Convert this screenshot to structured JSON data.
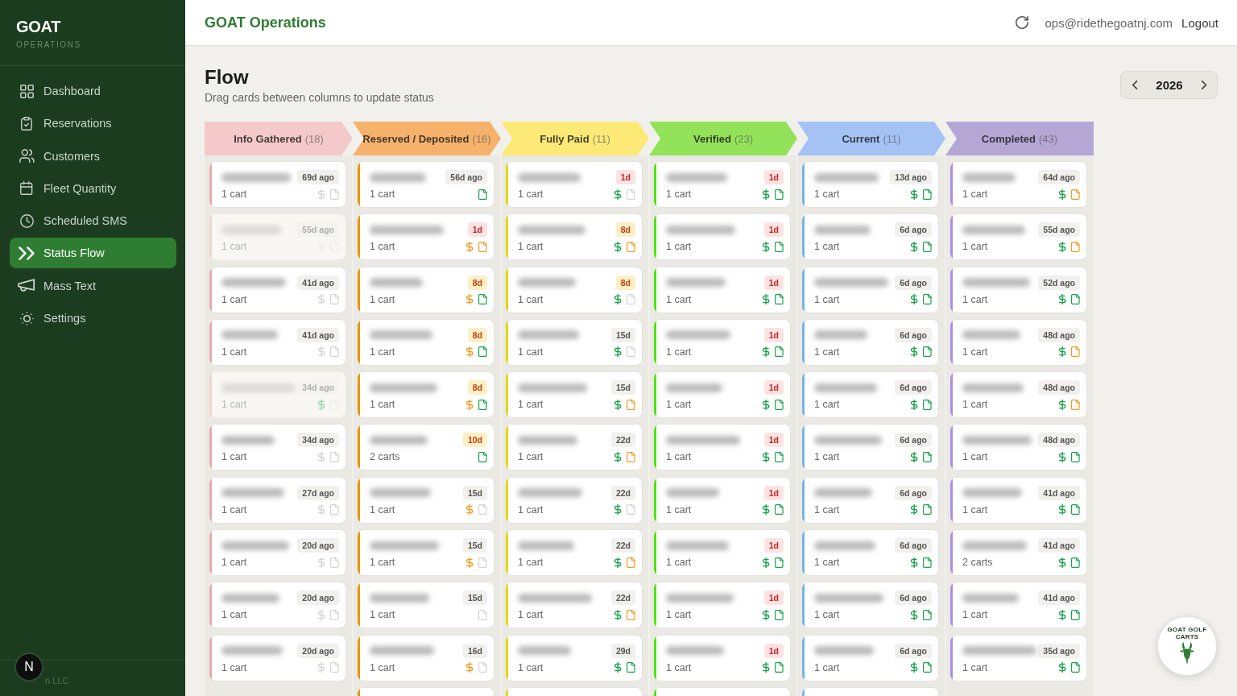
{
  "sidebar": {
    "brand": "GOAT",
    "brand_subtitle": "OPERATIONS",
    "items": [
      {
        "label": "Dashboard",
        "kind": "dashboard",
        "selected": false
      },
      {
        "label": "Reservations",
        "kind": "reservations",
        "selected": false
      },
      {
        "label": "Customers",
        "kind": "customers",
        "selected": false
      },
      {
        "label": "Fleet Quantity",
        "kind": "fleet",
        "selected": false
      },
      {
        "label": "Scheduled SMS",
        "kind": "sms",
        "selected": false
      },
      {
        "label": "Status Flow",
        "kind": "flow",
        "selected": true
      },
      {
        "label": "Mass Text",
        "kind": "mass_text",
        "selected": false
      },
      {
        "label": "Settings",
        "kind": "settings",
        "selected": false
      }
    ],
    "footer_text": "n LLC"
  },
  "header": {
    "title": "GOAT Operations",
    "email": "ops@ridethegoatnj.com",
    "logout": "Logout"
  },
  "page": {
    "title": "Flow",
    "subtitle": "Drag cards between columns to update status",
    "year": "2026"
  },
  "columns": [
    {
      "title": "Info Gathered",
      "count": "(18)",
      "color": "#f4c9c9",
      "more_below": false,
      "cards": [
        {
          "age": "69d ago",
          "urgent": false,
          "due_soon": false,
          "carts": "1 cart",
          "payment": {
            "color": "#d4d4d4"
          },
          "document": {
            "color": "#d4d4d4"
          },
          "dimmed": false
        },
        {
          "age": "55d ago",
          "urgent": false,
          "due_soon": false,
          "carts": "1 cart",
          "payment": {
            "color": "#ebebeb"
          },
          "document": {
            "color": "#ebebeb"
          },
          "dimmed": true
        },
        {
          "age": "41d ago",
          "urgent": false,
          "due_soon": false,
          "carts": "1 cart",
          "payment": {
            "color": "#d4d4d4"
          },
          "document": {
            "color": "#d4d4d4"
          },
          "dimmed": false
        },
        {
          "age": "41d ago",
          "urgent": false,
          "due_soon": false,
          "carts": "1 cart",
          "payment": {
            "color": "#d4d4d4"
          },
          "document": {
            "color": "#d4d4d4"
          },
          "dimmed": false
        },
        {
          "age": "34d ago",
          "urgent": false,
          "due_soon": false,
          "carts": "1 cart",
          "payment": {
            "color": "#96d6ae"
          },
          "document": {
            "color": "#ebebeb"
          },
          "dimmed": true
        },
        {
          "age": "34d ago",
          "urgent": false,
          "due_soon": false,
          "carts": "1 cart",
          "payment": {
            "color": "#d4d4d4"
          },
          "document": {
            "color": "#d4d4d4"
          },
          "dimmed": false
        },
        {
          "age": "27d ago",
          "urgent": false,
          "due_soon": false,
          "carts": "1 cart",
          "payment": {
            "color": "#d4d4d4"
          },
          "document": {
            "color": "#d4d4d4"
          },
          "dimmed": false
        },
        {
          "age": "20d ago",
          "urgent": false,
          "due_soon": false,
          "carts": "1 cart",
          "payment": {
            "color": "#d4d4d4"
          },
          "document": {
            "color": "#d4d4d4"
          },
          "dimmed": false
        },
        {
          "age": "20d ago",
          "urgent": false,
          "due_soon": false,
          "carts": "1 cart",
          "payment": {
            "color": "#d4d4d4"
          },
          "document": {
            "color": "#d4d4d4"
          },
          "dimmed": false
        },
        {
          "age": "20d ago",
          "urgent": false,
          "due_soon": false,
          "carts": "1 cart",
          "payment": {
            "color": "#d4d4d4"
          },
          "document": {
            "color": "#d4d4d4"
          },
          "dimmed": false
        }
      ]
    },
    {
      "title": "Reserved / Deposited",
      "count": "(16)",
      "color": "#f6b26b",
      "more_below": true,
      "cards": [
        {
          "age": "56d ago",
          "urgent": false,
          "due_soon": false,
          "carts": "1 cart",
          "document": {
            "color": "#16a34a"
          },
          "dimmed": false
        },
        {
          "age": "1d",
          "urgent": true,
          "due_soon": false,
          "carts": "1 cart",
          "payment": {
            "color": "#f39a1f"
          },
          "document": {
            "color": "#f39a1f"
          },
          "dimmed": false
        },
        {
          "age": "8d",
          "urgent": false,
          "due_soon": true,
          "carts": "1 cart",
          "payment": {
            "color": "#f39a1f"
          },
          "document": {
            "color": "#16a34a"
          },
          "dimmed": false
        },
        {
          "age": "8d",
          "urgent": false,
          "due_soon": true,
          "carts": "1 cart",
          "payment": {
            "color": "#f39a1f"
          },
          "document": {
            "color": "#16a34a"
          },
          "dimmed": false
        },
        {
          "age": "8d",
          "urgent": false,
          "due_soon": true,
          "carts": "1 cart",
          "payment": {
            "color": "#f39a1f"
          },
          "document": {
            "color": "#16a34a"
          },
          "dimmed": false
        },
        {
          "age": "10d",
          "urgent": false,
          "due_soon": true,
          "carts": "2 carts",
          "document": {
            "color": "#16a34a"
          },
          "dimmed": false
        },
        {
          "age": "15d",
          "urgent": false,
          "due_soon": false,
          "carts": "1 cart",
          "payment": {
            "color": "#f39a1f"
          },
          "document": {
            "color": "#d4d4d4"
          },
          "dimmed": false
        },
        {
          "age": "15d",
          "urgent": false,
          "due_soon": false,
          "carts": "1 cart",
          "payment": {
            "color": "#f39a1f"
          },
          "document": {
            "color": "#d4d4d4"
          },
          "dimmed": false
        },
        {
          "age": "15d",
          "urgent": false,
          "due_soon": false,
          "carts": "1 cart",
          "document": {
            "color": "#d4d4d4"
          },
          "dimmed": false
        },
        {
          "age": "16d",
          "urgent": false,
          "due_soon": false,
          "carts": "1 cart",
          "payment": {
            "color": "#f39a1f"
          },
          "document": {
            "color": "#d4d4d4"
          },
          "dimmed": false
        }
      ]
    },
    {
      "title": "Fully Paid",
      "count": "(11)",
      "color": "#fdea76",
      "more_below": true,
      "cards": [
        {
          "age": "1d",
          "urgent": true,
          "due_soon": false,
          "carts": "1 cart",
          "payment": {
            "color": "#16a34a"
          },
          "document": {
            "color": "#d4d4d4"
          },
          "dimmed": false
        },
        {
          "age": "8d",
          "urgent": false,
          "due_soon": true,
          "carts": "1 cart",
          "payment": {
            "color": "#16a34a"
          },
          "document": {
            "color": "#f39a1f"
          },
          "dimmed": false
        },
        {
          "age": "8d",
          "urgent": false,
          "due_soon": true,
          "carts": "1 cart",
          "payment": {
            "color": "#16a34a"
          },
          "document": {
            "color": "#d4d4d4"
          },
          "dimmed": false
        },
        {
          "age": "15d",
          "urgent": false,
          "due_soon": false,
          "carts": "1 cart",
          "payment": {
            "color": "#16a34a"
          },
          "document": {
            "color": "#d4d4d4"
          },
          "dimmed": false
        },
        {
          "age": "15d",
          "urgent": false,
          "due_soon": false,
          "carts": "1 cart",
          "payment": {
            "color": "#16a34a"
          },
          "document": {
            "color": "#f39a1f"
          },
          "dimmed": false
        },
        {
          "age": "22d",
          "urgent": false,
          "due_soon": false,
          "carts": "1 cart",
          "payment": {
            "color": "#16a34a"
          },
          "document": {
            "color": "#f39a1f"
          },
          "dimmed": false
        },
        {
          "age": "22d",
          "urgent": false,
          "due_soon": false,
          "carts": "1 cart",
          "payment": {
            "color": "#16a34a"
          },
          "document": {
            "color": "#d4d4d4"
          },
          "dimmed": false
        },
        {
          "age": "22d",
          "urgent": false,
          "due_soon": false,
          "carts": "1 cart",
          "payment": {
            "color": "#16a34a"
          },
          "document": {
            "color": "#f39a1f"
          },
          "dimmed": false
        },
        {
          "age": "22d",
          "urgent": false,
          "due_soon": false,
          "carts": "1 cart",
          "payment": {
            "color": "#16a34a"
          },
          "document": {
            "color": "#f39a1f"
          },
          "dimmed": false
        },
        {
          "age": "29d",
          "urgent": false,
          "due_soon": false,
          "carts": "1 cart",
          "payment": {
            "color": "#16a34a"
          },
          "document": {
            "color": "#16a34a"
          },
          "dimmed": false
        }
      ]
    },
    {
      "title": "Verified",
      "count": "(23)",
      "color": "#93e35a",
      "more_below": true,
      "cards": [
        {
          "age": "1d",
          "urgent": true,
          "due_soon": false,
          "carts": "1 cart",
          "payment": {
            "color": "#16a34a"
          },
          "document": {
            "color": "#16a34a"
          },
          "dimmed": false
        },
        {
          "age": "1d",
          "urgent": true,
          "due_soon": false,
          "carts": "1 cart",
          "payment": {
            "color": "#16a34a"
          },
          "document": {
            "color": "#16a34a"
          },
          "dimmed": false
        },
        {
          "age": "1d",
          "urgent": true,
          "due_soon": false,
          "carts": "1 cart",
          "payment": {
            "color": "#16a34a"
          },
          "document": {
            "color": "#16a34a"
          },
          "dimmed": false
        },
        {
          "age": "1d",
          "urgent": true,
          "due_soon": false,
          "carts": "1 cart",
          "payment": {
            "color": "#16a34a"
          },
          "document": {
            "color": "#16a34a"
          },
          "dimmed": false
        },
        {
          "age": "1d",
          "urgent": true,
          "due_soon": false,
          "carts": "1 cart",
          "payment": {
            "color": "#16a34a"
          },
          "document": {
            "color": "#16a34a"
          },
          "dimmed": false
        },
        {
          "age": "1d",
          "urgent": true,
          "due_soon": false,
          "carts": "1 cart",
          "payment": {
            "color": "#16a34a"
          },
          "document": {
            "color": "#16a34a"
          },
          "dimmed": false
        },
        {
          "age": "1d",
          "urgent": true,
          "due_soon": false,
          "carts": "1 cart",
          "payment": {
            "color": "#16a34a"
          },
          "document": {
            "color": "#16a34a"
          },
          "dimmed": false
        },
        {
          "age": "1d",
          "urgent": true,
          "due_soon": false,
          "carts": "1 cart",
          "payment": {
            "color": "#16a34a"
          },
          "document": {
            "color": "#16a34a"
          },
          "dimmed": false
        },
        {
          "age": "1d",
          "urgent": true,
          "due_soon": false,
          "carts": "1 cart",
          "payment": {
            "color": "#16a34a"
          },
          "document": {
            "color": "#16a34a"
          },
          "dimmed": false
        },
        {
          "age": "1d",
          "urgent": true,
          "due_soon": false,
          "carts": "1 cart",
          "payment": {
            "color": "#16a34a"
          },
          "document": {
            "color": "#16a34a"
          },
          "dimmed": false
        }
      ]
    },
    {
      "title": "Current",
      "count": "(11)",
      "color": "#a4c2f4",
      "more_below": true,
      "cards": [
        {
          "age": "13d ago",
          "urgent": false,
          "due_soon": false,
          "carts": "1 cart",
          "payment": {
            "color": "#16a34a"
          },
          "document": {
            "color": "#16a34a"
          },
          "dimmed": false
        },
        {
          "age": "6d ago",
          "urgent": false,
          "due_soon": false,
          "carts": "1 cart",
          "payment": {
            "color": "#16a34a"
          },
          "document": {
            "color": "#16a34a"
          },
          "dimmed": false
        },
        {
          "age": "6d ago",
          "urgent": false,
          "due_soon": false,
          "carts": "1 cart",
          "payment": {
            "color": "#16a34a"
          },
          "document": {
            "color": "#16a34a"
          },
          "dimmed": false
        },
        {
          "age": "6d ago",
          "urgent": false,
          "due_soon": false,
          "carts": "1 cart",
          "payment": {
            "color": "#16a34a"
          },
          "document": {
            "color": "#16a34a"
          },
          "dimmed": false
        },
        {
          "age": "6d ago",
          "urgent": false,
          "due_soon": false,
          "carts": "1 cart",
          "payment": {
            "color": "#16a34a"
          },
          "document": {
            "color": "#16a34a"
          },
          "dimmed": false
        },
        {
          "age": "6d ago",
          "urgent": false,
          "due_soon": false,
          "carts": "1 cart",
          "payment": {
            "color": "#16a34a"
          },
          "document": {
            "color": "#16a34a"
          },
          "dimmed": false
        },
        {
          "age": "6d ago",
          "urgent": false,
          "due_soon": false,
          "carts": "1 cart",
          "payment": {
            "color": "#16a34a"
          },
          "document": {
            "color": "#16a34a"
          },
          "dimmed": false
        },
        {
          "age": "6d ago",
          "urgent": false,
          "due_soon": false,
          "carts": "1 cart",
          "payment": {
            "color": "#16a34a"
          },
          "document": {
            "color": "#16a34a"
          },
          "dimmed": false
        },
        {
          "age": "6d ago",
          "urgent": false,
          "due_soon": false,
          "carts": "1 cart",
          "payment": {
            "color": "#16a34a"
          },
          "document": {
            "color": "#16a34a"
          },
          "dimmed": false
        },
        {
          "age": "6d ago",
          "urgent": false,
          "due_soon": false,
          "carts": "1 cart",
          "payment": {
            "color": "#16a34a"
          },
          "document": {
            "color": "#16a34a"
          },
          "dimmed": false
        }
      ]
    },
    {
      "title": "Completed",
      "count": "(43)",
      "color": "#b4a7d6",
      "more_below": false,
      "cards": [
        {
          "age": "64d ago",
          "urgent": false,
          "due_soon": false,
          "carts": "1 cart",
          "payment": {
            "color": "#16a34a"
          },
          "document": {
            "color": "#f39a1f"
          },
          "dimmed": false
        },
        {
          "age": "55d ago",
          "urgent": false,
          "due_soon": false,
          "carts": "1 cart",
          "payment": {
            "color": "#16a34a"
          },
          "document": {
            "color": "#f39a1f"
          },
          "dimmed": false
        },
        {
          "age": "52d ago",
          "urgent": false,
          "due_soon": false,
          "carts": "1 cart",
          "payment": {
            "color": "#16a34a"
          },
          "document": {
            "color": "#16a34a"
          },
          "dimmed": false
        },
        {
          "age": "48d ago",
          "urgent": false,
          "due_soon": false,
          "carts": "1 cart",
          "payment": {
            "color": "#16a34a"
          },
          "document": {
            "color": "#f39a1f"
          },
          "dimmed": false
        },
        {
          "age": "48d ago",
          "urgent": false,
          "due_soon": false,
          "carts": "1 cart",
          "payment": {
            "color": "#16a34a"
          },
          "document": {
            "color": "#f39a1f"
          },
          "dimmed": false
        },
        {
          "age": "48d ago",
          "urgent": false,
          "due_soon": false,
          "carts": "1 cart",
          "payment": {
            "color": "#16a34a"
          },
          "document": {
            "color": "#16a34a"
          },
          "dimmed": false
        },
        {
          "age": "41d ago",
          "urgent": false,
          "due_soon": false,
          "carts": "1 cart",
          "payment": {
            "color": "#16a34a"
          },
          "document": {
            "color": "#16a34a"
          },
          "dimmed": false
        },
        {
          "age": "41d ago",
          "urgent": false,
          "due_soon": false,
          "carts": "2 carts",
          "payment": {
            "color": "#16a34a"
          },
          "document": {
            "color": "#16a34a"
          },
          "dimmed": false
        },
        {
          "age": "41d ago",
          "urgent": false,
          "due_soon": false,
          "carts": "1 cart",
          "payment": {
            "color": "#16a34a"
          },
          "document": {
            "color": "#16a34a"
          },
          "dimmed": false
        },
        {
          "age": "35d ago",
          "urgent": false,
          "due_soon": false,
          "carts": "1 cart",
          "payment": {
            "color": "#16a34a"
          },
          "document": {
            "color": "#16a34a"
          },
          "dimmed": false
        }
      ]
    }
  ],
  "logo": {
    "text": "GOAT GOLF CARTS"
  },
  "dev_badge": {
    "letter": "N"
  }
}
